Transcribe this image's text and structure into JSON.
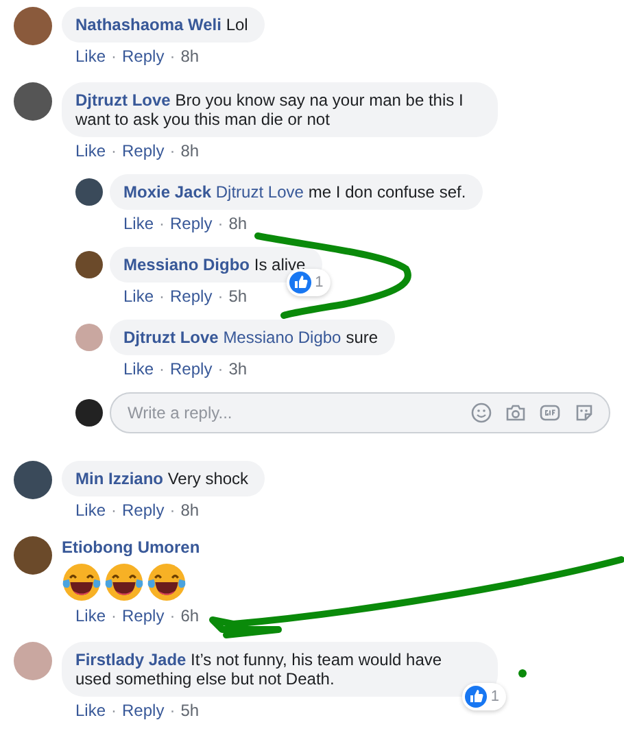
{
  "comments": [
    {
      "kind": "text",
      "author": "Nathashaoma Weli",
      "text": "Lol",
      "like": "Like",
      "sep": "·",
      "reply": "Reply",
      "time": "8h"
    },
    {
      "kind": "text",
      "author": "Djtruzt Love",
      "text": "Bro you know say na your man be this I want to ask you this man die or not",
      "like": "Like",
      "sep": "·",
      "reply": "Reply",
      "time": "8h",
      "replies": [
        {
          "kind": "text",
          "author": "Moxie Jack",
          "mention": "Djtruzt Love",
          "text": "me I don confuse sef.",
          "like": "Like",
          "sep": "·",
          "reply": "Reply",
          "time": "8h"
        },
        {
          "kind": "text",
          "author": "Messiano Digbo",
          "text": "Is alive",
          "reaction_count": "1",
          "like": "Like",
          "sep": "·",
          "reply": "Reply",
          "time": "5h"
        },
        {
          "kind": "text",
          "author": "Djtruzt Love",
          "mention": "Messiano Digbo",
          "text": "sure",
          "like": "Like",
          "sep": "·",
          "reply": "Reply",
          "time": "3h"
        }
      ],
      "reply_box": {
        "placeholder": "Write a reply..."
      }
    },
    {
      "kind": "text",
      "author": "Min Izziano",
      "text": "Very shock",
      "like": "Like",
      "sep": "·",
      "reply": "Reply",
      "time": "8h"
    },
    {
      "kind": "emoji",
      "author": "Etiobong Umoren",
      "like": "Like",
      "sep": "·",
      "reply": "Reply",
      "time": "6h"
    },
    {
      "kind": "text",
      "author": "Firstlady Jade",
      "text": "It’s not funny, his team would have used something else but not Death.",
      "reaction_count": "1",
      "like": "Like",
      "sep": "·",
      "reply": "Reply",
      "time": "5h"
    }
  ]
}
